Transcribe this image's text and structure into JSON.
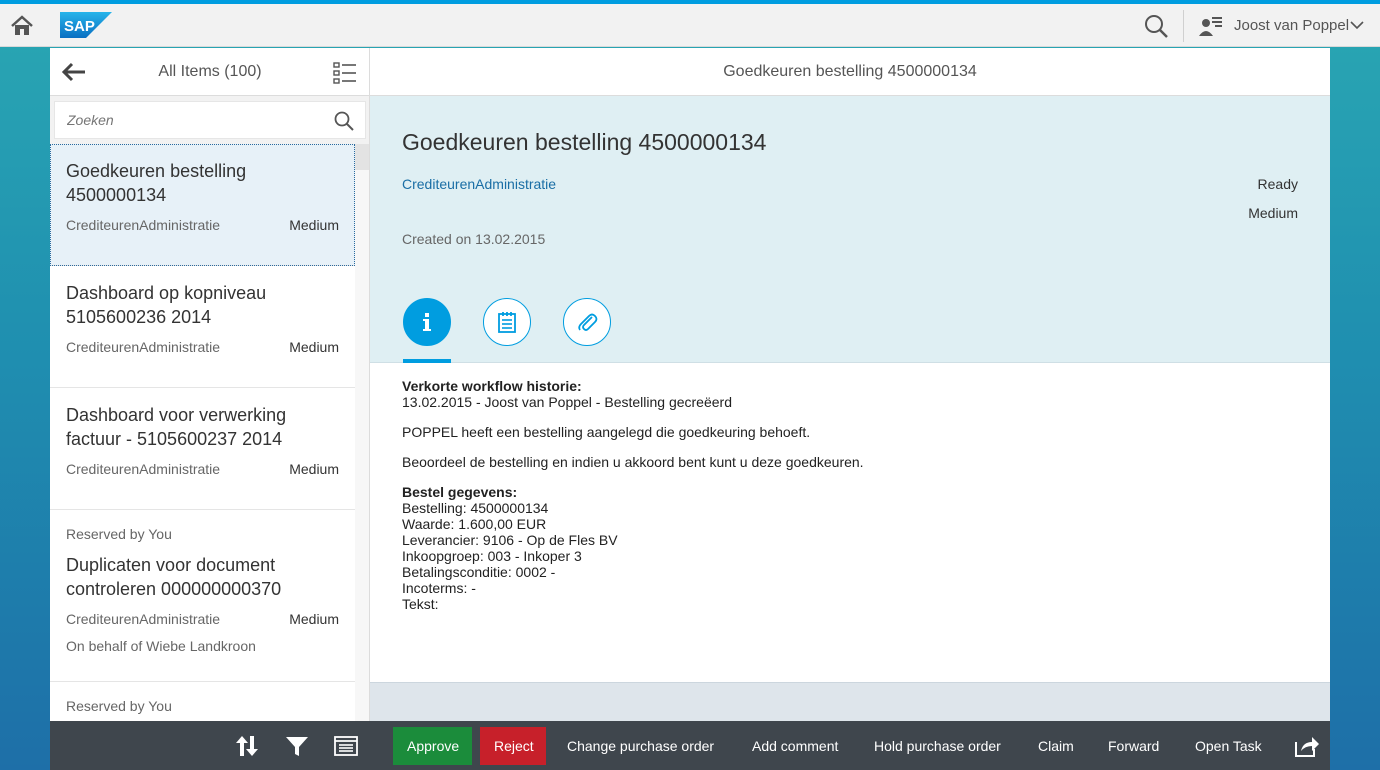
{
  "shell": {
    "user_name": "Joost van Poppel",
    "logo_text": "SAP"
  },
  "master": {
    "title": "All Items (100)",
    "search_placeholder": "Zoeken",
    "items": [
      {
        "pre": "",
        "title": "Goedkeuren bestelling 4500000134",
        "sub": "CrediteurenAdministratie",
        "priority": "Medium",
        "behalf": ""
      },
      {
        "pre": "",
        "title": "Dashboard op kopniveau 5105600236 2014",
        "sub": "CrediteurenAdministratie",
        "priority": "Medium",
        "behalf": ""
      },
      {
        "pre": "",
        "title": "Dashboard voor verwerking factuur - 5105600237 2014",
        "sub": "CrediteurenAdministratie",
        "priority": "Medium",
        "behalf": ""
      },
      {
        "pre": "Reserved by You",
        "title": "Duplicaten voor document controleren 000000000370",
        "sub": "CrediteurenAdministratie",
        "priority": "Medium",
        "behalf": "On behalf of Wiebe Landkroon"
      },
      {
        "pre": "Reserved by You",
        "title": "",
        "sub": "",
        "priority": "",
        "behalf": ""
      }
    ]
  },
  "detail": {
    "header_title": "Goedkeuren bestelling 4500000134",
    "object_title": "Goedkeuren bestelling 4500000134",
    "object_link": "CrediteurenAdministratie",
    "status": "Ready",
    "priority": "Medium",
    "created": "Created on 13.02.2015",
    "description": {
      "history_heading": "Verkorte workflow historie:",
      "history_line": "13.02.2015 - Joost van Poppel - Bestelling gecreëerd",
      "para1": "POPPEL heeft een bestelling aangelegd die goedkeuring behoeft.",
      "para2": "Beoordeel de bestelling en indien u akkoord bent kunt u deze goedkeuren.",
      "order_heading": "Bestel gegevens:",
      "order_lines": [
        "Bestelling: 4500000134",
        "Waarde: 1.600,00 EUR",
        "Leverancier: 9106 - Op de Fles BV",
        "Inkoopgroep: 003 - Inkoper 3",
        "Betalingsconditie: 0002 -",
        "Incoterms: -",
        "Tekst:"
      ]
    }
  },
  "footer": {
    "approve": "Approve",
    "reject": "Reject",
    "change_po": "Change purchase order",
    "add_comment": "Add comment",
    "hold_po": "Hold purchase order",
    "claim": "Claim",
    "forward": "Forward",
    "open_task": "Open Task"
  },
  "colors": {
    "accent": "#009de0",
    "approve": "#1b8c3b",
    "reject": "#c7202a",
    "toolbar": "#3f464d",
    "header_bg": "#dfeff3"
  }
}
